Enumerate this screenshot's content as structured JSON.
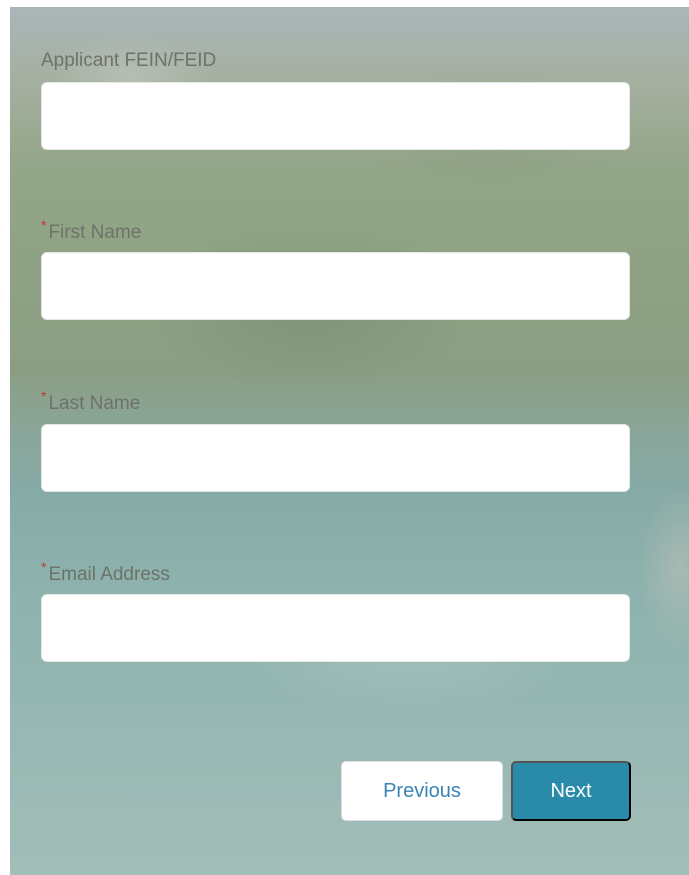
{
  "form": {
    "fields": [
      {
        "label": "Applicant FEIN/FEID",
        "required": false,
        "value": ""
      },
      {
        "label": "First Name",
        "required": true,
        "value": ""
      },
      {
        "label": "Last Name",
        "required": true,
        "value": ""
      },
      {
        "label": "Email Address",
        "required": true,
        "value": ""
      }
    ],
    "required_marker": "*"
  },
  "buttons": {
    "previous_label": "Previous",
    "next_label": "Next"
  },
  "colors": {
    "required": "#c23934",
    "next_button": "#2a8aa9",
    "previous_text": "#3a84b4"
  }
}
